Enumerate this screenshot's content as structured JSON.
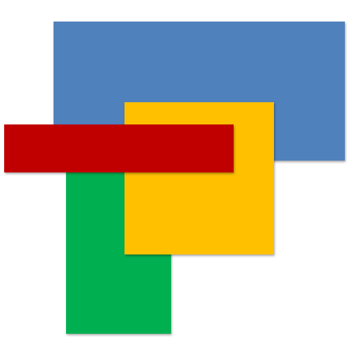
{
  "logo": {
    "tiles": [
      {
        "id": "blue",
        "color": "#4f81bd"
      },
      {
        "id": "green",
        "color": "#00b050"
      },
      {
        "id": "yellow",
        "color": "#ffc000"
      },
      {
        "id": "red",
        "color": "#c00000"
      }
    ]
  }
}
